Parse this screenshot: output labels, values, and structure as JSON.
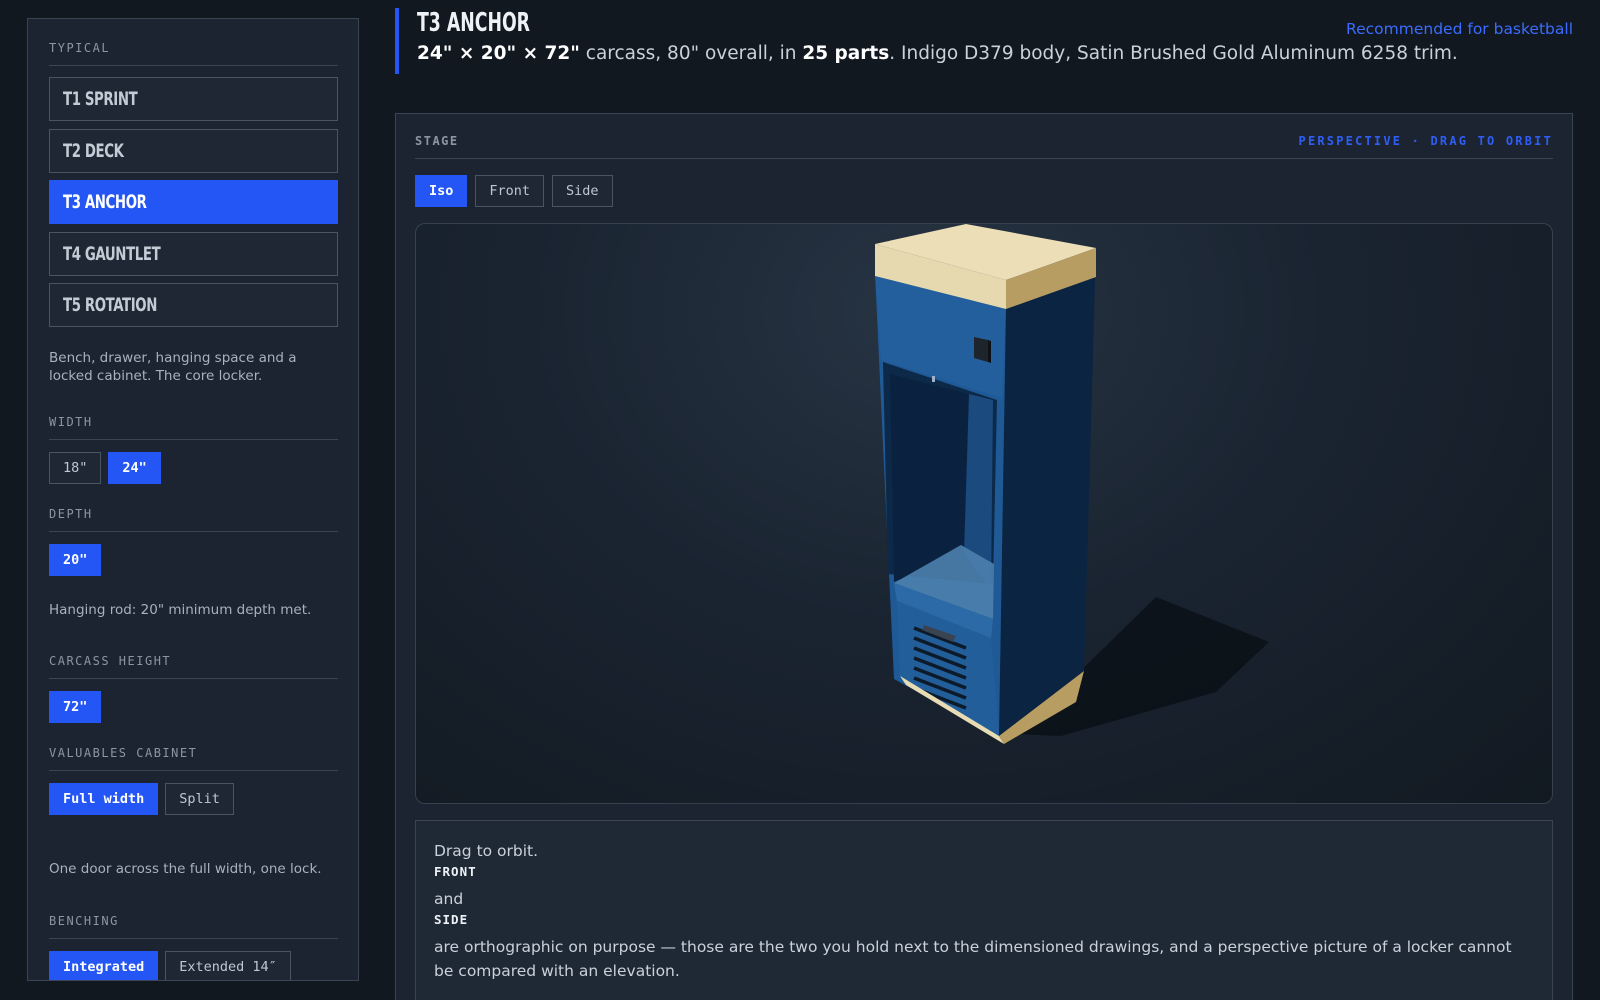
{
  "sidebar": {
    "section_label": "TYPICAL",
    "models": [
      {
        "label": "T1 SPRINT",
        "active": false
      },
      {
        "label": "T2 DECK",
        "active": false
      },
      {
        "label": "T3 ANCHOR",
        "active": true
      },
      {
        "label": "T4 GAUNTLET",
        "active": false
      },
      {
        "label": "T5 ROTATION",
        "active": false
      }
    ],
    "model_description": "Bench, drawer, hanging space and a locked cabinet. The core locker.",
    "width": {
      "label": "WIDTH",
      "options": [
        "18\"",
        "24\""
      ],
      "selected": "24\""
    },
    "depth": {
      "label": "DEPTH",
      "options": [
        "20\""
      ],
      "selected": "20\"",
      "note": "Hanging rod: 20\" minimum depth met."
    },
    "carcass_height": {
      "label": "CARCASS HEIGHT",
      "options": [
        "72\""
      ],
      "selected": "72\""
    },
    "valuables_cabinet": {
      "label": "VALUABLES CABINET",
      "options": [
        "Full width",
        "Split"
      ],
      "selected": "Full width",
      "note": "One door across the full width, one lock."
    },
    "benching": {
      "label": "BENCHING",
      "options": [
        "Integrated",
        "Extended 14″"
      ],
      "selected": "Integrated"
    }
  },
  "header": {
    "title": "T3 ANCHOR",
    "dims": "24\" × 20\" × 72\"",
    "text_1": " carcass, 80\" overall, in ",
    "parts": "25 parts",
    "text_2": ". Indigo D379 body, Satin Brushed Gold Aluminum 6258 trim.",
    "recommendation": "Recommended for basketball"
  },
  "stage": {
    "label": "STAGE",
    "mode": "PERSPECTIVE · DRAG TO ORBIT",
    "views": [
      {
        "label": "Iso",
        "active": true
      },
      {
        "label": "Front",
        "active": false
      },
      {
        "label": "Side",
        "active": false
      }
    ],
    "colors": {
      "body": "#1f5a96",
      "body_dark": "#0b2442",
      "trim": "#e8dcb5",
      "trim_dark": "#b79d62",
      "accent": "#2356f5"
    }
  },
  "help": {
    "line_1": "Drag to orbit.",
    "kbd_front": "FRONT",
    "line_2": "and",
    "kbd_side": "SIDE",
    "line_3": "are orthographic on purpose — those are the two you hold next to the dimensioned drawings, and a perspective picture of a locker cannot be compared with an elevation."
  }
}
